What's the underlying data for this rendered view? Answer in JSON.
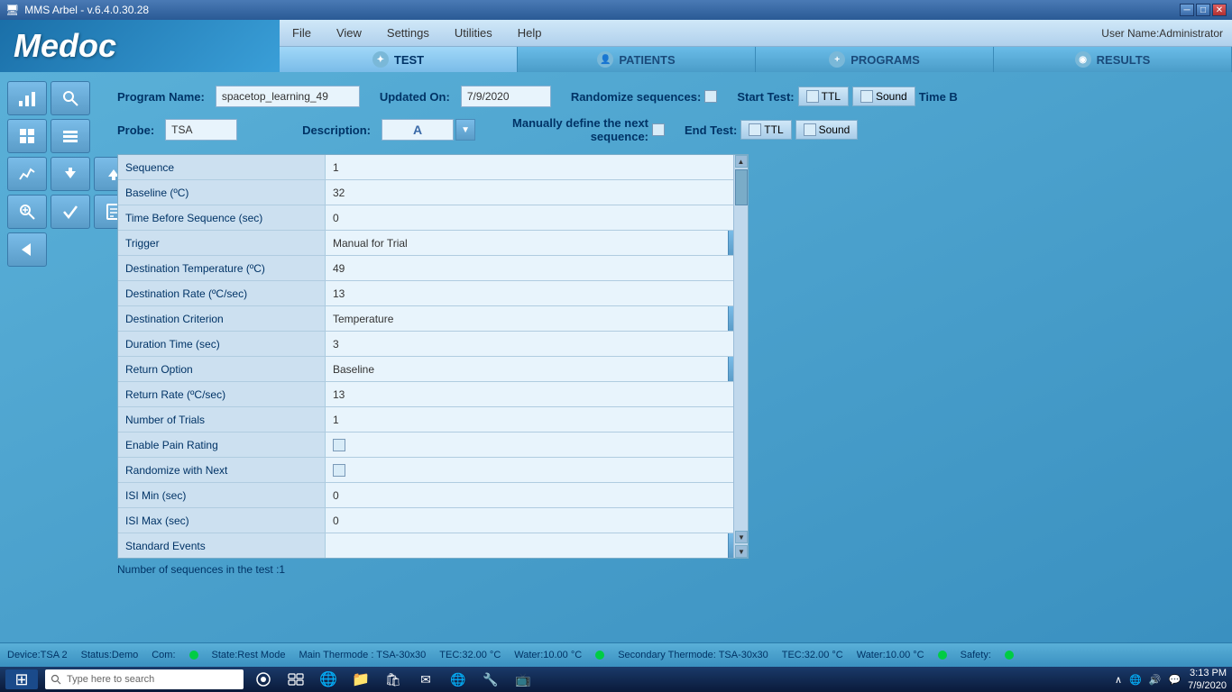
{
  "titlebar": {
    "title": "MMS Arbel - v.6.4.0.30.28",
    "controls": [
      "minimize",
      "maximize",
      "close"
    ]
  },
  "menu": {
    "items": [
      "File",
      "View",
      "Settings",
      "Utilities",
      "Help"
    ],
    "user": "User Name:Administrator"
  },
  "logo": "Medoc",
  "nav": {
    "tabs": [
      {
        "label": "TEST",
        "active": true
      },
      {
        "label": "PATIENTS",
        "active": false
      },
      {
        "label": "PROGRAMS",
        "active": false
      },
      {
        "label": "RESULTS",
        "active": false
      }
    ]
  },
  "program": {
    "name_label": "Program Name:",
    "name_value": "spacetop_learning_49",
    "updated_label": "Updated On:",
    "updated_value": "7/9/2020",
    "randomize_label": "Randomize sequences:",
    "start_test_label": "Start Test:",
    "ttl_label": "TTL",
    "sound_label": "Sound",
    "time_b_label": "Time B",
    "probe_label": "Probe:",
    "probe_value": "TSA",
    "description_label": "Description:",
    "manually_label": "Manually define the next sequence:",
    "end_test_label": "End Test:"
  },
  "sequence": {
    "rows": [
      {
        "label": "Sequence",
        "value": "1",
        "type": "text"
      },
      {
        "label": "Baseline (ºC)",
        "value": "32",
        "type": "text"
      },
      {
        "label": "Time Before Sequence (sec)",
        "value": "0",
        "type": "text"
      },
      {
        "label": "Trigger",
        "value": "Manual for Trial",
        "type": "dropdown"
      },
      {
        "label": "Destination Temperature (ºC)",
        "value": "49",
        "type": "text"
      },
      {
        "label": "Destination Rate (ºC/sec)",
        "value": "13",
        "type": "text"
      },
      {
        "label": "Destination Criterion",
        "value": "Temperature",
        "type": "dropdown"
      },
      {
        "label": "Duration Time (sec)",
        "value": "3",
        "type": "text"
      },
      {
        "label": "Return Option",
        "value": "Baseline",
        "type": "dropdown"
      },
      {
        "label": "Return Rate (ºC/sec)",
        "value": "13",
        "type": "text"
      },
      {
        "label": "Number of Trials",
        "value": "1",
        "type": "text"
      },
      {
        "label": "Enable Pain Rating",
        "value": "",
        "type": "checkbox"
      },
      {
        "label": "Randomize with Next",
        "value": "",
        "type": "checkbox2"
      },
      {
        "label": "ISI Min (sec)",
        "value": "0",
        "type": "text"
      },
      {
        "label": "ISI Max (sec)",
        "value": "0",
        "type": "text"
      },
      {
        "label": "Standard Events",
        "value": "",
        "type": "dropdown-empty"
      }
    ],
    "count_label": "Number of sequences in the test :1"
  },
  "statusbar": {
    "device": "Device:TSA 2",
    "status": "Status:Demo",
    "com": "Com:",
    "state": "State:Rest Mode",
    "main_thermode": "Main Thermode : TSA-30x30",
    "tec": "TEC:32.00 °C",
    "water": "Water:10.00 °C",
    "secondary": "Secondary Thermode: TSA-30x30",
    "tec2": "TEC:32.00 °C",
    "water2": "Water:10.00 °C",
    "safety": "Safety:"
  },
  "taskbar": {
    "search_placeholder": "Type here to search",
    "time": "3:13 PM",
    "date": "7/9/2020"
  },
  "sidebar_buttons": [
    {
      "icon": "📊",
      "name": "chart-btn"
    },
    {
      "icon": "🔍",
      "name": "search-btn"
    },
    {
      "icon": "⬛",
      "name": "block-btn"
    },
    {
      "icon": "📋",
      "name": "list-btn"
    },
    {
      "icon": "📈",
      "name": "graph-btn"
    },
    {
      "icon": "⬇",
      "name": "down-btn"
    },
    {
      "icon": "⬆",
      "name": "up-btn"
    },
    {
      "icon": "🔎",
      "name": "zoom-btn"
    },
    {
      "icon": "✓",
      "name": "check-btn"
    },
    {
      "icon": "📄",
      "name": "doc-btn"
    },
    {
      "icon": "◀",
      "name": "back-btn"
    }
  ]
}
